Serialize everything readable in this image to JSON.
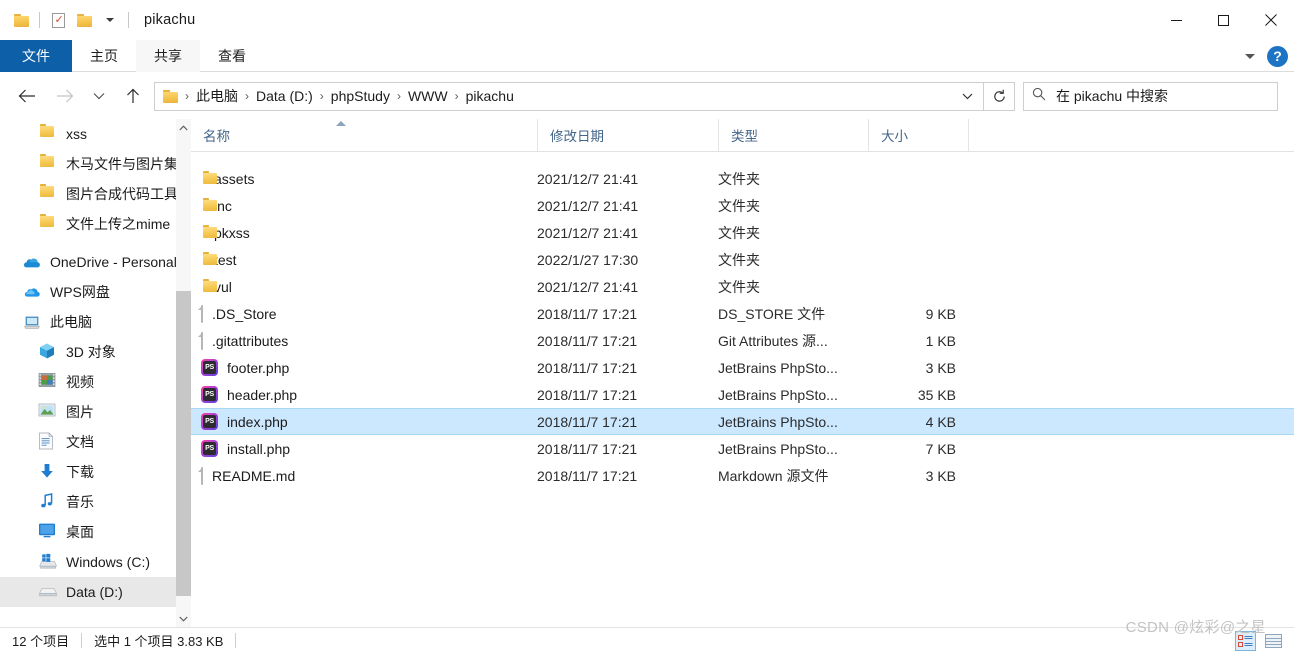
{
  "window": {
    "title": "pikachu",
    "quick_access": [
      {
        "name": "folder-icon",
        "label": "文件资源管理器"
      },
      {
        "name": "properties-icon",
        "label": "属性"
      },
      {
        "name": "new-folder-icon",
        "label": "新建文件夹"
      },
      {
        "name": "customize-caret-icon",
        "label": "自定义快速访问工具栏"
      }
    ],
    "controls": [
      {
        "name": "minimize-button",
        "label": "最小化"
      },
      {
        "name": "maximize-button",
        "label": "最大化"
      },
      {
        "name": "close-button",
        "label": "关闭"
      }
    ]
  },
  "ribbon": {
    "tabs": [
      {
        "label": "文件",
        "state": "file"
      },
      {
        "label": "主页",
        "state": "normal"
      },
      {
        "label": "共享",
        "state": "active"
      },
      {
        "label": "查看",
        "state": "normal"
      }
    ],
    "expand_label": "",
    "help_label": "?"
  },
  "address": {
    "back_label": "后退",
    "forward_label": "前进",
    "recent_label": "最近使用的位置",
    "up_label": "上移一级",
    "crumbs": [
      "此电脑",
      "Data (D:)",
      "phpStudy",
      "WWW",
      "pikachu"
    ],
    "separator": "›",
    "refresh_label": "刷新"
  },
  "search": {
    "placeholder": "在 pikachu 中搜索"
  },
  "nav": {
    "items": [
      {
        "label": "xss",
        "icon": "folder-icon",
        "indent": 3,
        "selected": false
      },
      {
        "label": "木马文件与图片集",
        "icon": "folder-icon",
        "indent": 3,
        "selected": false
      },
      {
        "label": "图片合成代码工具",
        "icon": "folder-icon",
        "indent": 3,
        "selected": false
      },
      {
        "label": "文件上传之mime",
        "icon": "folder-icon",
        "indent": 3,
        "selected": false
      },
      {
        "label": "OneDrive - Personal",
        "icon": "onedrive-icon",
        "indent": 1,
        "selected": false
      },
      {
        "label": "WPS网盘",
        "icon": "wps-cloud-icon",
        "indent": 1,
        "selected": false
      },
      {
        "label": "此电脑",
        "icon": "this-pc-icon",
        "indent": 1,
        "selected": false
      },
      {
        "label": "3D 对象",
        "icon": "3d-objects-icon",
        "indent": 2,
        "selected": false
      },
      {
        "label": "视频",
        "icon": "videos-icon",
        "indent": 2,
        "selected": false
      },
      {
        "label": "图片",
        "icon": "pictures-icon",
        "indent": 2,
        "selected": false
      },
      {
        "label": "文档",
        "icon": "documents-icon",
        "indent": 2,
        "selected": false
      },
      {
        "label": "下载",
        "icon": "downloads-icon",
        "indent": 2,
        "selected": false
      },
      {
        "label": "音乐",
        "icon": "music-icon",
        "indent": 2,
        "selected": false
      },
      {
        "label": "桌面",
        "icon": "desktop-icon",
        "indent": 2,
        "selected": false
      },
      {
        "label": "Windows (C:)",
        "icon": "windows-drive-icon",
        "indent": 2,
        "selected": false
      },
      {
        "label": "Data (D:)",
        "icon": "drive-icon",
        "indent": 2,
        "selected": true
      }
    ]
  },
  "columns": [
    {
      "label": "名称",
      "key": "name",
      "sorted": "asc"
    },
    {
      "label": "修改日期",
      "key": "date",
      "sorted": null
    },
    {
      "label": "类型",
      "key": "type",
      "sorted": null
    },
    {
      "label": "大小",
      "key": "size",
      "sorted": null
    }
  ],
  "files": [
    {
      "name": "assets",
      "date": "2021/12/7 21:41",
      "type": "文件夹",
      "size": "",
      "icon": "folder-icon",
      "selected": false
    },
    {
      "name": "inc",
      "date": "2021/12/7 21:41",
      "type": "文件夹",
      "size": "",
      "icon": "folder-icon",
      "selected": false
    },
    {
      "name": "pkxss",
      "date": "2021/12/7 21:41",
      "type": "文件夹",
      "size": "",
      "icon": "folder-icon",
      "selected": false
    },
    {
      "name": "test",
      "date": "2022/1/27 17:30",
      "type": "文件夹",
      "size": "",
      "icon": "folder-icon",
      "selected": false
    },
    {
      "name": "vul",
      "date": "2021/12/7 21:41",
      "type": "文件夹",
      "size": "",
      "icon": "folder-icon",
      "selected": false
    },
    {
      "name": ".DS_Store",
      "date": "2018/11/7 17:21",
      "type": "DS_STORE 文件",
      "size": "9 KB",
      "icon": "generic-file-icon",
      "selected": false
    },
    {
      "name": ".gitattributes",
      "date": "2018/11/7 17:21",
      "type": "Git Attributes 源...",
      "size": "1 KB",
      "icon": "generic-file-icon",
      "selected": false
    },
    {
      "name": "footer.php",
      "date": "2018/11/7 17:21",
      "type": "JetBrains PhpSto...",
      "size": "3 KB",
      "icon": "phpstorm-icon",
      "selected": false
    },
    {
      "name": "header.php",
      "date": "2018/11/7 17:21",
      "type": "JetBrains PhpSto...",
      "size": "35 KB",
      "icon": "phpstorm-icon",
      "selected": false
    },
    {
      "name": "index.php",
      "date": "2018/11/7 17:21",
      "type": "JetBrains PhpSto...",
      "size": "4 KB",
      "icon": "phpstorm-icon",
      "selected": true
    },
    {
      "name": "install.php",
      "date": "2018/11/7 17:21",
      "type": "JetBrains PhpSto...",
      "size": "7 KB",
      "icon": "phpstorm-icon",
      "selected": false
    },
    {
      "name": "README.md",
      "date": "2018/11/7 17:21",
      "type": "Markdown 源文件",
      "size": "3 KB",
      "icon": "generic-file-icon",
      "selected": false
    }
  ],
  "status": {
    "item_count": "12 个项目",
    "selection": "选中 1 个项目  3.83 KB",
    "view_details_label": "详细信息",
    "view_large_label": "大图标"
  },
  "watermark": "CSDN @炫彩@之星",
  "colors": {
    "file_tab_blue": "#0d5fa8",
    "selection_blue": "#cce8ff",
    "selection_border": "#a8d6f5",
    "header_text": "#44668a",
    "nav_selected": "#e8e8e8",
    "folder_yellow": "#f6c953"
  }
}
